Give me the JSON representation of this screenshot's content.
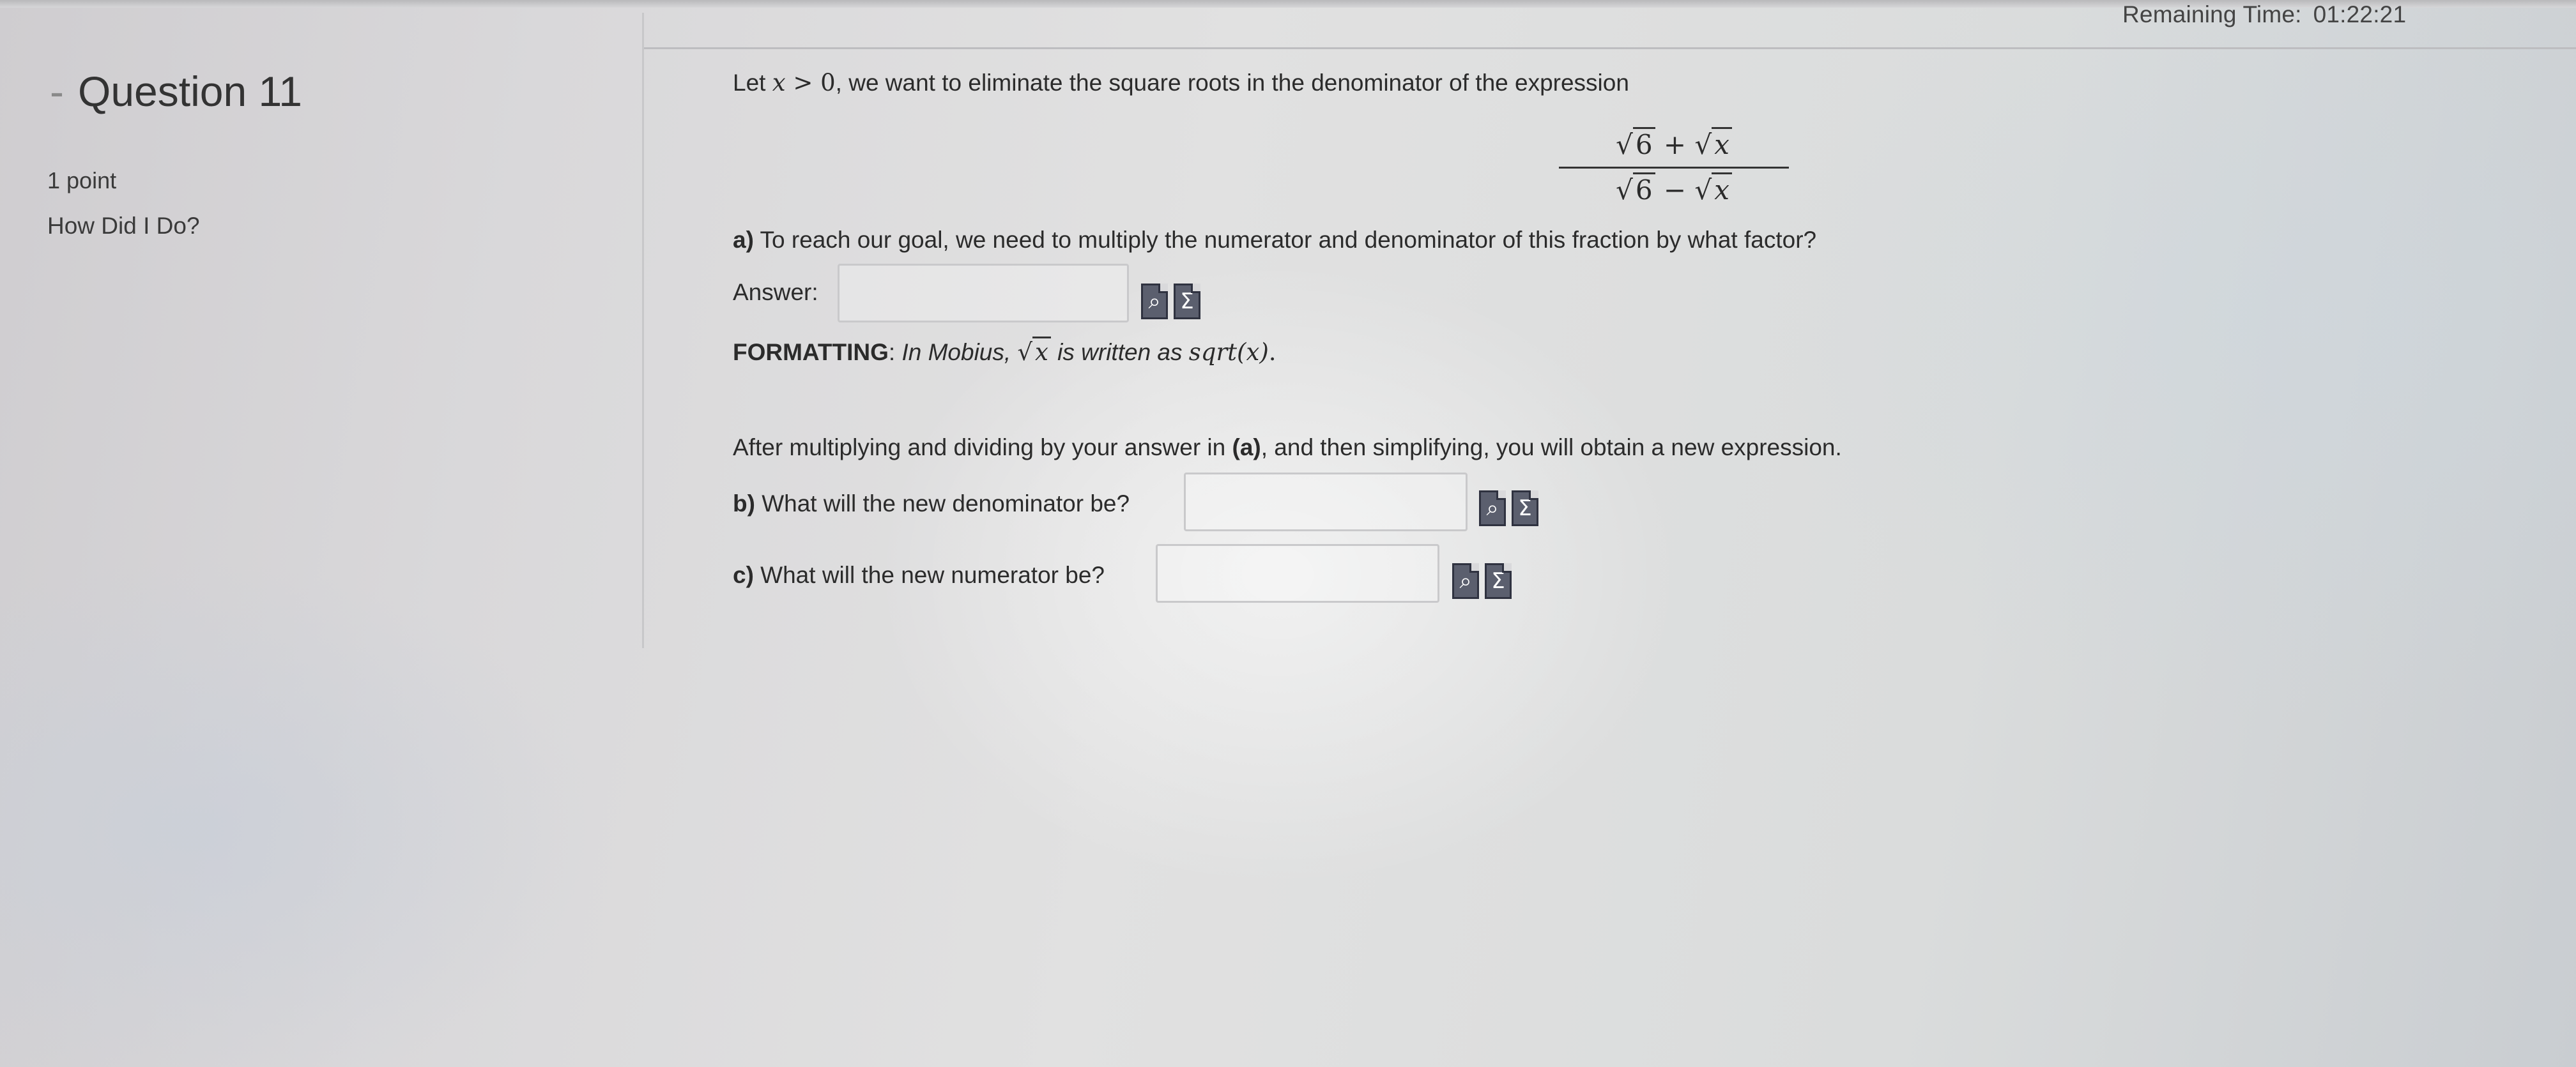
{
  "timer": {
    "label": "Remaining Time:",
    "value": "01:22:21"
  },
  "sidebar": {
    "dash": "-",
    "question_title": "Question 11",
    "points": "1 point",
    "how_did_i_do": "How Did I Do?"
  },
  "question": {
    "intro_before": "Let ",
    "intro_var": "x",
    "intro_op": " > 0",
    "intro_after": ", we want to eliminate the square roots in the denominator of the expression",
    "fraction": {
      "num_a": "6",
      "num_op": " + ",
      "num_b": "x",
      "den_a": "6",
      "den_op": " − ",
      "den_b": "x"
    },
    "part_a_label": "a)",
    "part_a_text": " To reach our goal, we need to multiply the numerator and denominator of this fraction by what factor?",
    "answer_label": "Answer:",
    "formatting_label": "FORMATTING",
    "formatting_colon": ":",
    "formatting_text1": " In Mobius, ",
    "formatting_sqrt_var": "x",
    "formatting_text2": " is written as ",
    "formatting_code": "sqrt(x)",
    "formatting_end": ".",
    "after_text1": "After multiplying and dividing by your answer in ",
    "after_bold": "(a)",
    "after_text2": ", and then simplifying, you will obtain a new expression.",
    "part_b_label": "b)",
    "part_b_text": " What will the new denominator be?",
    "part_c_label": "c)",
    "part_c_text": " What will the new numerator be?"
  },
  "icons": {
    "preview": "preview-icon",
    "equation_editor": "sigma-icon",
    "sigma_glyph": "Σ",
    "preview_glyph": "⌕"
  }
}
